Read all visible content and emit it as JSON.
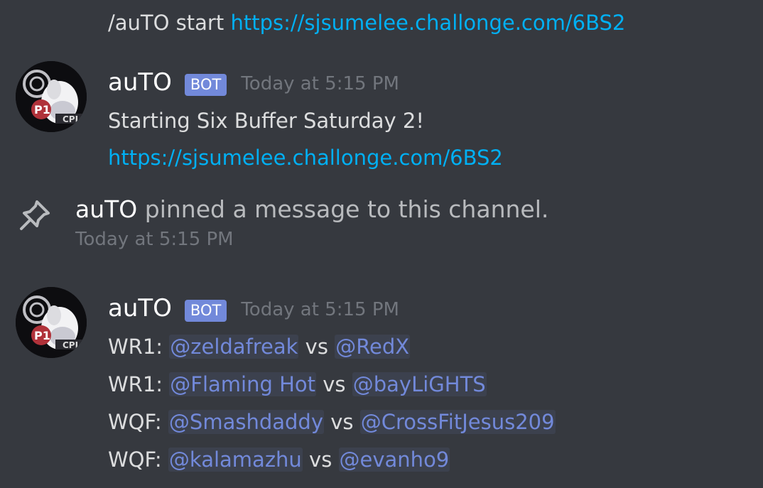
{
  "command_message": {
    "text": "/auTO start ",
    "link": "https://sjsumelee.challonge.com/6BS2"
  },
  "message1": {
    "username": "auTO",
    "bot_tag": "BOT",
    "timestamp": "Today at 5:15 PM",
    "text": "Starting Six Buffer Saturday 2!",
    "link": "https://sjsumelee.challonge.com/6BS2"
  },
  "system_message": {
    "actor": "auTO",
    "action": " pinned a message to this channel.",
    "timestamp": "Today at 5:15 PM",
    "icon": "pin-icon"
  },
  "message2": {
    "username": "auTO",
    "bot_tag": "BOT",
    "timestamp": "Today at 5:15 PM",
    "matches": [
      {
        "round": "WR1: ",
        "p1": "@zeldafreak",
        "vs": " vs ",
        "p2": "@RedX"
      },
      {
        "round": "WR1: ",
        "p1": "@Flaming Hot",
        "vs": " vs ",
        "p2": "@bayLiGHTS"
      },
      {
        "round": "WQF: ",
        "p1": "@Smashdaddy",
        "vs": " vs ",
        "p2": "@CrossFitJesus209"
      },
      {
        "round": "WQF: ",
        "p1": "@kalamazhu",
        "vs": " vs ",
        "p2": "@evanho9"
      }
    ]
  },
  "avatar": {
    "badge_text": "P1",
    "icon": "avatar-icon"
  },
  "colors": {
    "background": "#36393f",
    "link": "#00b0f4",
    "mention": "#7289da",
    "bot_tag": "#7289da",
    "timestamp": "#72767d"
  }
}
